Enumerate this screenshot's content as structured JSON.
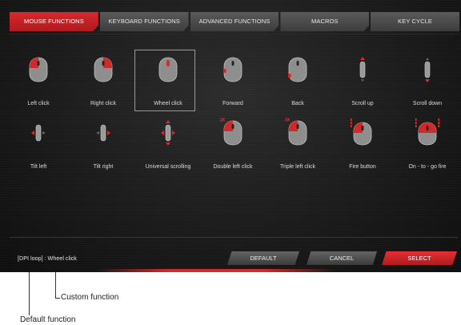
{
  "tabs": [
    {
      "label": "MOUSE FUNCTIONS",
      "active": true
    },
    {
      "label": "KEYBOARD FUNCTIONS",
      "active": false
    },
    {
      "label": "ADVANCED FUNCTIONS",
      "active": false
    },
    {
      "label": "MACROS",
      "active": false
    },
    {
      "label": "KEY CYCLE",
      "active": false
    }
  ],
  "functions_row1": [
    {
      "label": "Left click",
      "icon": "mouse-left-click-icon"
    },
    {
      "label": "Right click",
      "icon": "mouse-right-click-icon"
    },
    {
      "label": "Wheel click",
      "icon": "mouse-wheel-click-icon",
      "selected": true
    },
    {
      "label": "Forward",
      "icon": "mouse-forward-icon"
    },
    {
      "label": "Back",
      "icon": "mouse-back-icon"
    },
    {
      "label": "Scroll up",
      "icon": "scroll-up-icon"
    },
    {
      "label": "Scroll down",
      "icon": "scroll-down-icon"
    }
  ],
  "functions_row2": [
    {
      "label": "Tilt left",
      "icon": "tilt-left-icon"
    },
    {
      "label": "Tilt right",
      "icon": "tilt-right-icon"
    },
    {
      "label": "Universal scrolling",
      "icon": "universal-scrolling-icon"
    },
    {
      "label": "Double left click",
      "icon": "double-left-click-icon",
      "badge": "2X"
    },
    {
      "label": "Triple left click",
      "icon": "triple-left-click-icon",
      "badge": "3X"
    },
    {
      "label": "Fire button",
      "icon": "fire-button-icon"
    },
    {
      "label": "On - to - go fire",
      "icon": "on-the-go-fire-icon"
    }
  ],
  "status": "[DPI loop] : Wheel click",
  "buttons": {
    "default": "DEFAULT",
    "cancel": "CANCEL",
    "select": "SELECT"
  },
  "callouts": {
    "custom": "Custom function",
    "default": "Default function"
  },
  "colors": {
    "accent": "#c8232b",
    "panel": "#1b1b1b",
    "button": "#4a4a4a"
  }
}
